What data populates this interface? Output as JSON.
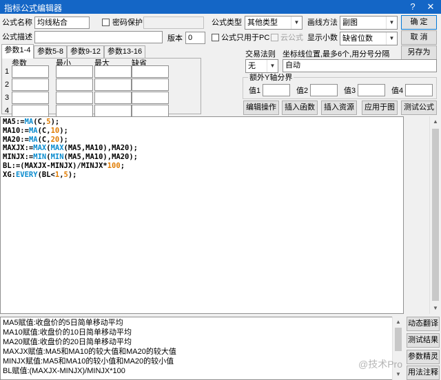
{
  "window": {
    "title": "指标公式编辑器",
    "help_label": "?",
    "close_label": "✕"
  },
  "form": {
    "name_label": "公式名称",
    "name_value": "均线粘合",
    "password_label": "密码保护",
    "description_label": "公式描述",
    "description_value": "",
    "version_label": "版本",
    "version_value": "0",
    "formula_type_label": "公式类型",
    "formula_type_value": "其他类型",
    "draw_method_label": "画线方法",
    "draw_method_value": "副图",
    "pc_only_label": "公式只用于PC",
    "cloud_label": "云公式",
    "decimals_label": "显示小数",
    "decimals_value": "缺省位数"
  },
  "buttons": {
    "ok": "确 定",
    "cancel": "取 消",
    "save_as": "另存为",
    "edit_ops": "编辑操作",
    "insert_func": "插入函数",
    "insert_resource": "插入资源",
    "apply_chart": "应用于图",
    "test_formula": "测试公式"
  },
  "tabs": [
    "参数1-4",
    "参数5-8",
    "参数9-12",
    "参数13-16"
  ],
  "params": {
    "headers": [
      "参数",
      "最小",
      "最大",
      "缺省"
    ],
    "rows": [
      "1",
      "2",
      "3",
      "4"
    ]
  },
  "trade": {
    "rule_label": "交易法则",
    "rule_value": "无",
    "coord_label": "坐标线位置,最多6个,用分号分隔",
    "coord_value": "自动",
    "extra_y_label": "额外Y轴分界",
    "values": [
      "值1",
      "值2",
      "值3",
      "值4"
    ]
  },
  "code": [
    [
      {
        "t": "MA5:="
      },
      {
        "t": "MA",
        "c": "k"
      },
      {
        "t": "(C,"
      },
      {
        "t": "5",
        "c": "n"
      },
      {
        "t": ");"
      }
    ],
    [
      {
        "t": "MA10:="
      },
      {
        "t": "MA",
        "c": "k"
      },
      {
        "t": "(C,"
      },
      {
        "t": "10",
        "c": "n"
      },
      {
        "t": ");"
      }
    ],
    [
      {
        "t": "MA20:="
      },
      {
        "t": "MA",
        "c": "k"
      },
      {
        "t": "(C,"
      },
      {
        "t": "20",
        "c": "n"
      },
      {
        "t": ");"
      }
    ],
    [
      {
        "t": "MAXJX:="
      },
      {
        "t": "MAX",
        "c": "k"
      },
      {
        "t": "("
      },
      {
        "t": "MAX",
        "c": "k"
      },
      {
        "t": "(MA5,MA10),MA20);"
      }
    ],
    [
      {
        "t": "MINJX:="
      },
      {
        "t": "MIN",
        "c": "k"
      },
      {
        "t": "("
      },
      {
        "t": "MIN",
        "c": "k"
      },
      {
        "t": "(MA5,MA10),MA20);"
      }
    ],
    [
      {
        "t": "BL:=(MAXJX-MINJX)/MINJX*"
      },
      {
        "t": "100",
        "c": "n"
      },
      {
        "t": ";"
      }
    ],
    [
      {
        "t": "XG:"
      },
      {
        "t": "EVERY",
        "c": "k"
      },
      {
        "t": "(BL<"
      },
      {
        "t": "1",
        "c": "n"
      },
      {
        "t": ","
      },
      {
        "t": "5",
        "c": "n"
      },
      {
        "t": ");"
      }
    ]
  ],
  "explanation": [
    "MA5赋值:收盘价的5日简单移动平均",
    "MA10赋值:收盘价的10日简单移动平均",
    "MA20赋值:收盘价的20日简单移动平均",
    "MAXJX赋值:MA5和MA10的较大值和MA20的较大值",
    "MINJX赋值:MA5和MA10的较小值和MA20的较小值",
    "BL赋值:(MAXJX-MINJX)/MINJX*100"
  ],
  "side_buttons": [
    "动态翻译",
    "测试结果",
    "参数精灵",
    "用法注释"
  ],
  "watermark": "@技术Pro",
  "icons": {
    "dropdown": "chevron-down-icon",
    "scroll_up": "arrow-up-icon",
    "scroll_down": "arrow-down-icon"
  }
}
